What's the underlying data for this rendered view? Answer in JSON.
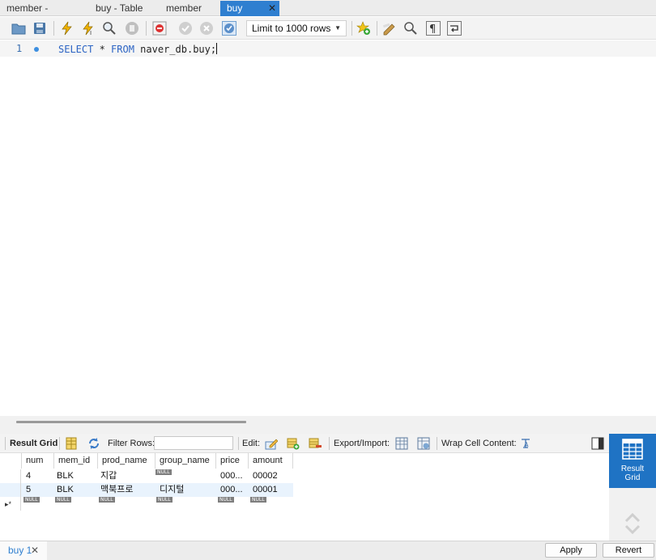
{
  "tabs": [
    {
      "label": "member - Table"
    },
    {
      "label": "buy - Table"
    },
    {
      "label": "member"
    },
    {
      "label": "buy",
      "close": "✕"
    }
  ],
  "toolbar": {
    "limit_value": "Limit to 1000 rows"
  },
  "editor": {
    "line_number": "1",
    "kw1": "SELECT",
    "star": " * ",
    "kw2": "FROM",
    "rest": " naver_db.buy;"
  },
  "result_toolbar": {
    "result_grid": "Result Grid",
    "filter_rows": "Filter Rows:",
    "filter_value": "",
    "edit": "Edit:",
    "export_import": "Export/Import:",
    "wrap": "Wrap Cell Content:"
  },
  "grid": {
    "columns": [
      "num",
      "mem_id",
      "prod_name",
      "group_name",
      "price",
      "amount"
    ],
    "rows": [
      {
        "num": "4",
        "mem_id": "BLK",
        "prod_name": "지갑",
        "group_name": "NULL",
        "price": "000...",
        "amount": "00002"
      },
      {
        "num": "5",
        "mem_id": "BLK",
        "prod_name": "맥북프로",
        "group_name": "디지털",
        "price": "000...",
        "amount": "00001"
      }
    ],
    "new_row_marker": "▸*",
    "null_label": "NULL"
  },
  "side": {
    "result_grid_line1": "Result",
    "result_grid_line2": "Grid"
  },
  "bottom": {
    "tab_label": "buy 1",
    "tab_close": "✕",
    "apply": "Apply",
    "revert": "Revert"
  },
  "colors": {
    "accent": "#2f7fd0",
    "keyword": "#2c64c4"
  }
}
